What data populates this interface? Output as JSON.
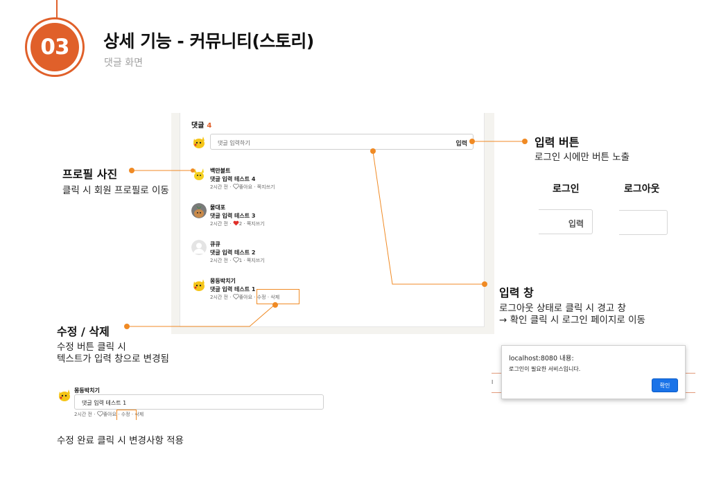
{
  "header": {
    "badge_number": "03",
    "title": "상세 기능 - 커뮤니티(스토리)",
    "subtitle": "댓글 화면"
  },
  "comments_panel": {
    "title": "댓글",
    "count": "4",
    "input_placeholder": "댓글 입력하기",
    "input_button": "입력",
    "comments": [
      {
        "author": "백만볼트",
        "text": "댓글 입력 테스트 4",
        "time": "2시간 전",
        "likes": "좋아요",
        "liked": false,
        "reply": "쪽지쓰기"
      },
      {
        "author": "물대포",
        "text": "댓글 입력 테스트 3",
        "time": "2시간 전",
        "likes": "2",
        "liked": true,
        "reply": "쪽지쓰기"
      },
      {
        "author": "큐큐",
        "text": "댓글 입력 테스트 2",
        "time": "2시간 전",
        "likes": "1",
        "liked": false,
        "reply": "쪽지쓰기"
      },
      {
        "author": "몽둥박치기",
        "text": "댓글 입력 테스트 1",
        "time": "2시간 전",
        "likes": "좋아요",
        "liked": false,
        "edit": "수정",
        "delete": "삭제"
      }
    ]
  },
  "annotations": {
    "profile": {
      "heading": "프로필 사진",
      "desc": "클릭 시 회원 프로필로 이동"
    },
    "input_button": {
      "heading": "입력 버튼",
      "desc": "로그인 시에만 버튼 노출"
    },
    "input_field": {
      "heading": "입력 창",
      "desc_line1": "로그아웃 상태로 클릭 시 경고 창",
      "desc_line2": "→ 확인 클릭 시 로그인 페이지로 이동"
    },
    "edit_delete": {
      "heading": "수정 / 삭제",
      "desc_line1": "수정 버튼 클릭 시",
      "desc_line2": "텍스트가 입력 창으로 변경됨"
    },
    "edit_done": {
      "desc": "수정 완료 클릭 시 변경사항 적용"
    }
  },
  "login_compare": {
    "login_label": "로그인",
    "logout_label": "로그아웃",
    "login_button": "입력"
  },
  "alert": {
    "title": "localhost:8080 내용:",
    "message": "로그인이 필요한 서비스입니다.",
    "ok": "확인"
  },
  "edit_preview": {
    "author": "몽둥박치기",
    "input_value": "댓글 입력 테스트 1",
    "time": "2시간 전",
    "likes": "좋아요",
    "edit": "수정",
    "delete": "삭제"
  },
  "colors": {
    "accent": "#e0602a",
    "callout": "#f08a24",
    "heart": "#e0302a",
    "dialog_button": "#1a73e8"
  }
}
